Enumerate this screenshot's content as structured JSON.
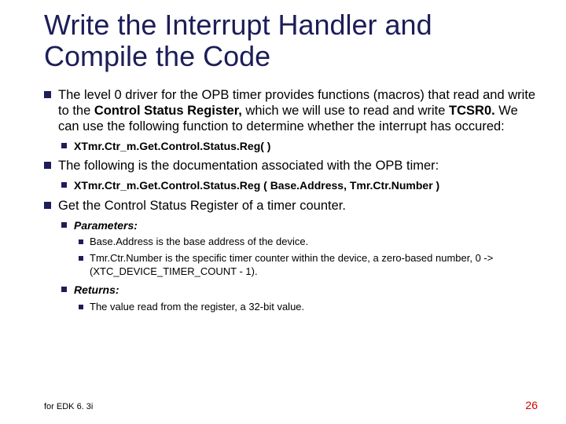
{
  "title": "Write the Interrupt Handler and Compile the Code",
  "b1": {
    "pre": "The level 0 driver for the OPB timer provides functions (macros) that read and write to the ",
    "bold1": "Control Status Register,",
    "mid": " which we will use to read and write ",
    "bold2": "TCSR0.",
    "post": " We can use the following function to determine whether the interrupt has occured:"
  },
  "b1a": "XTmr.Ctr_m.Get.Control.Status.Reg( )",
  "b2": "The following is the documentation associated with the OPB timer:",
  "b2a": "XTmr.Ctr_m.Get.Control.Status.Reg ( Base.Address, Tmr.Ctr.Number )",
  "b3": "Get the Control Status Register of a timer counter.",
  "params_label": "Parameters:",
  "p1": "Base.Address is the base address of the device.",
  "p2": "Tmr.Ctr.Number is the specific timer counter within the device, a zero-based number, 0 -> (XTC_DEVICE_TIMER_COUNT - 1).",
  "returns_label": "Returns:",
  "r1": "The value read from the register, a 32-bit value.",
  "footer_left": "for EDK 6. 3i",
  "footer_right": "26"
}
